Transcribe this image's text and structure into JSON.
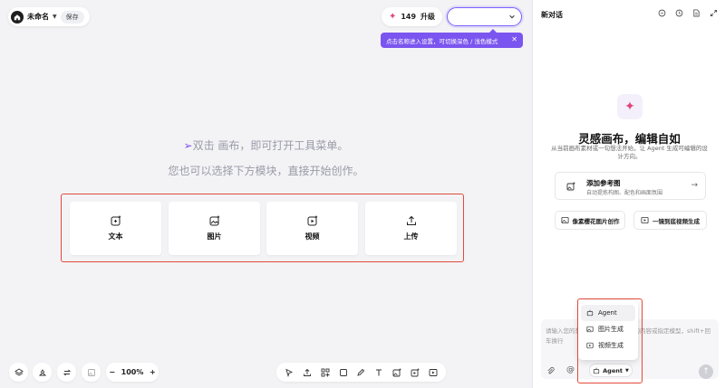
{
  "header": {
    "project_name": "未命名",
    "save_label": "保存",
    "credits": "149",
    "upgrade_label": "升级",
    "tooltip": "点击名称进入设置，可切换深色 / 浅色模式"
  },
  "canvas": {
    "hint_line1": "双击 画布，即可打开工具菜单。",
    "hint_line2": "您也可以选择下方模块，直接开始创作。",
    "cards": [
      {
        "label": "文本",
        "icon": "text-plus-icon"
      },
      {
        "label": "图片",
        "icon": "image-plus-icon"
      },
      {
        "label": "视频",
        "icon": "video-plus-icon"
      },
      {
        "label": "上传",
        "icon": "upload-icon"
      }
    ],
    "zoom": "100%",
    "zoom_minus": "−",
    "zoom_plus": "+"
  },
  "panel": {
    "title": "新对话",
    "heading": "灵感画布，编辑自如",
    "subtitle": "从当前画布素材或一句想法开始，让 Agent 生成可编辑的设计方向。",
    "reference": {
      "title": "添加参考图",
      "desc": "自动提炼构图、配色和画面氛围"
    },
    "quick_actions": [
      "像素樱花图片创作",
      "一镜到底视频生成"
    ],
    "input_placeholder": "请输入您的想法，可@引用画布中的内容或指定模型，shift+回车换行",
    "agent_label": "Agent",
    "menu": [
      "Agent",
      "图片生成",
      "视频生成"
    ]
  },
  "colors": {
    "accent": "#7b55ef",
    "highlight_box": "#e24a3b",
    "sparkle": "#e0457b"
  }
}
